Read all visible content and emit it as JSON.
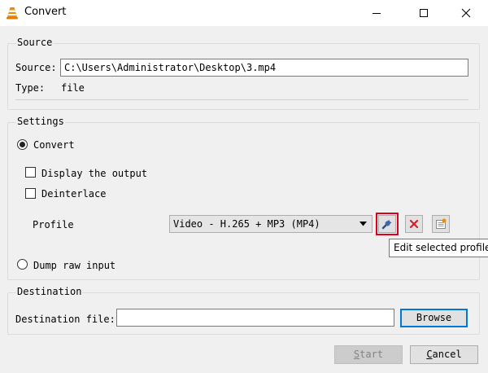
{
  "window": {
    "title": "Convert"
  },
  "source": {
    "legend": "Source",
    "source_label": "Source:",
    "source_value": "C:\\Users\\Administrator\\Desktop\\3.mp4",
    "type_label": "Type:",
    "type_value": "file"
  },
  "settings": {
    "legend": "Settings",
    "convert_label": "Convert",
    "display_output_label": "Display the output",
    "deinterlace_label": "Deinterlace",
    "profile_label": "Profile",
    "profile_selected": "Video - H.265 + MP3 (MP4)",
    "dump_raw_label": "Dump raw input",
    "tooltip": "Edit selected profile"
  },
  "destination": {
    "legend": "Destination",
    "file_label": "Destination file:",
    "file_value": "",
    "browse_label": "Browse"
  },
  "buttons": {
    "start_first": "S",
    "start_rest": "tart",
    "cancel_first": "C",
    "cancel_rest": "ancel"
  },
  "colors": {
    "highlight": "#e0001b",
    "delete_icon": "#d61f26",
    "default_button_border": "#0078d7",
    "vlc_orange": "#f08c00"
  }
}
